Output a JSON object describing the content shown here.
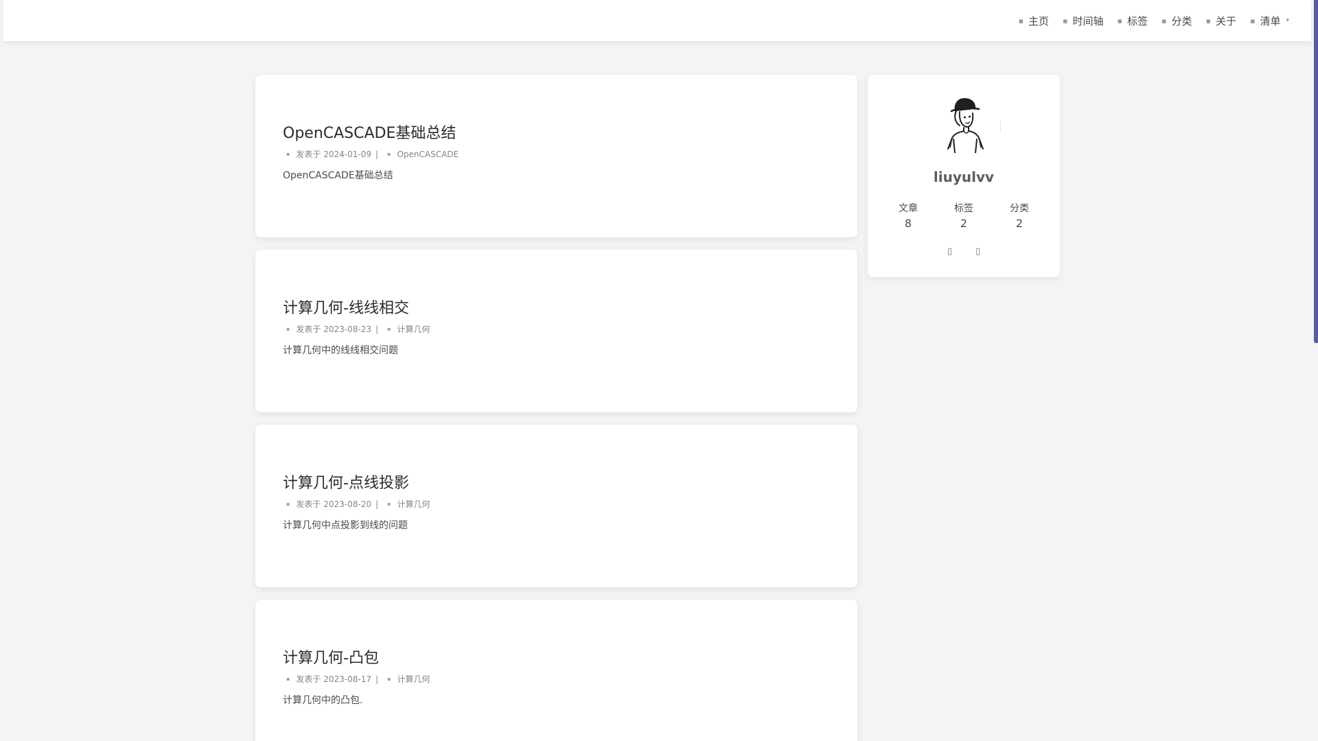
{
  "nav": {
    "items": [
      {
        "label": "主页",
        "icon": "home-icon"
      },
      {
        "label": "时间轴",
        "icon": "archive-icon"
      },
      {
        "label": "标签",
        "icon": "tags-icon"
      },
      {
        "label": "分类",
        "icon": "folder-icon"
      },
      {
        "label": "关于",
        "icon": "heart-icon"
      },
      {
        "label": "清单",
        "icon": "list-icon",
        "caret": "chevron-down-icon"
      }
    ]
  },
  "posts": [
    {
      "title": "OpenCASCADE基础总结",
      "date_label": "发表于 2024-01-09",
      "separator": "|",
      "category": "OpenCASCADE",
      "excerpt": "OpenCASCADE基础总结"
    },
    {
      "title": "计算几何-线线相交",
      "date_label": "发表于 2023-08-23",
      "separator": "|",
      "category": "计算几何",
      "excerpt": "计算几何中的线线相交问题"
    },
    {
      "title": "计算几何-点线投影",
      "date_label": "发表于 2023-08-20",
      "separator": "|",
      "category": "计算几何",
      "excerpt": "计算几何中点投影到线的问题"
    },
    {
      "title": "计算几何-凸包",
      "date_label": "发表于 2023-08-17",
      "separator": "|",
      "category": "计算几何",
      "excerpt": "计算几何中的凸包."
    }
  ],
  "author": {
    "name": "liuyulvv",
    "stats": [
      {
        "label": "文章",
        "value": "8"
      },
      {
        "label": "标签",
        "value": "2"
      },
      {
        "label": "分类",
        "value": "2"
      }
    ],
    "social_icons": [
      "github-icon",
      "email-icon"
    ]
  },
  "colors": {
    "background": "#f4f4f5",
    "card": "#ffffff",
    "text": "#4c4948",
    "meta": "#858585",
    "scrollbar": "#5a5aa0"
  }
}
